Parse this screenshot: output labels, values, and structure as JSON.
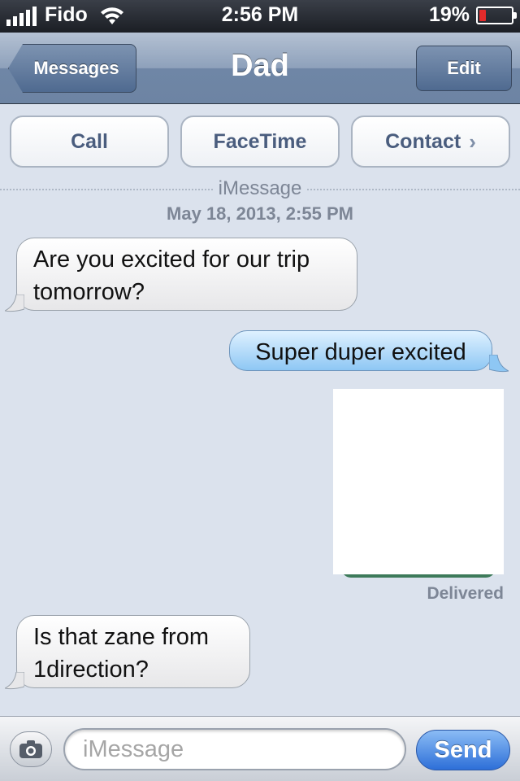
{
  "status_bar": {
    "carrier": "Fido",
    "time": "2:56 PM",
    "battery_percent": "19%",
    "battery_level": 0.19,
    "signal_icon": "signal-bars-icon",
    "wifi_icon": "wifi-icon"
  },
  "nav": {
    "back_label": "Messages",
    "title": "Dad",
    "edit_label": "Edit"
  },
  "actions": {
    "call_label": "Call",
    "facetime_label": "FaceTime",
    "contact_label": "Contact",
    "contact_chevron": "›"
  },
  "conversation": {
    "service": "iMessage",
    "timestamp": "May 18, 2013, 2:55 PM",
    "messages": [
      {
        "direction": "incoming",
        "text": "Are you excited for our trip tomorrow?"
      },
      {
        "direction": "outgoing",
        "text": "Super duper excited"
      },
      {
        "direction": "outgoing",
        "type": "image"
      },
      {
        "direction": "incoming",
        "text": "Is that zane from 1direction?"
      }
    ],
    "delivered_label": "Delivered"
  },
  "composer": {
    "placeholder": "iMessage",
    "value": "",
    "send_label": "Send",
    "camera_icon": "camera-icon"
  },
  "colors": {
    "background": "#dbe2ed",
    "nav_bar": "#6d84a3",
    "outgoing_bubble": "#8ec7f4",
    "incoming_bubble": "#e7e7e9",
    "send_button": "#2d6fd8"
  }
}
